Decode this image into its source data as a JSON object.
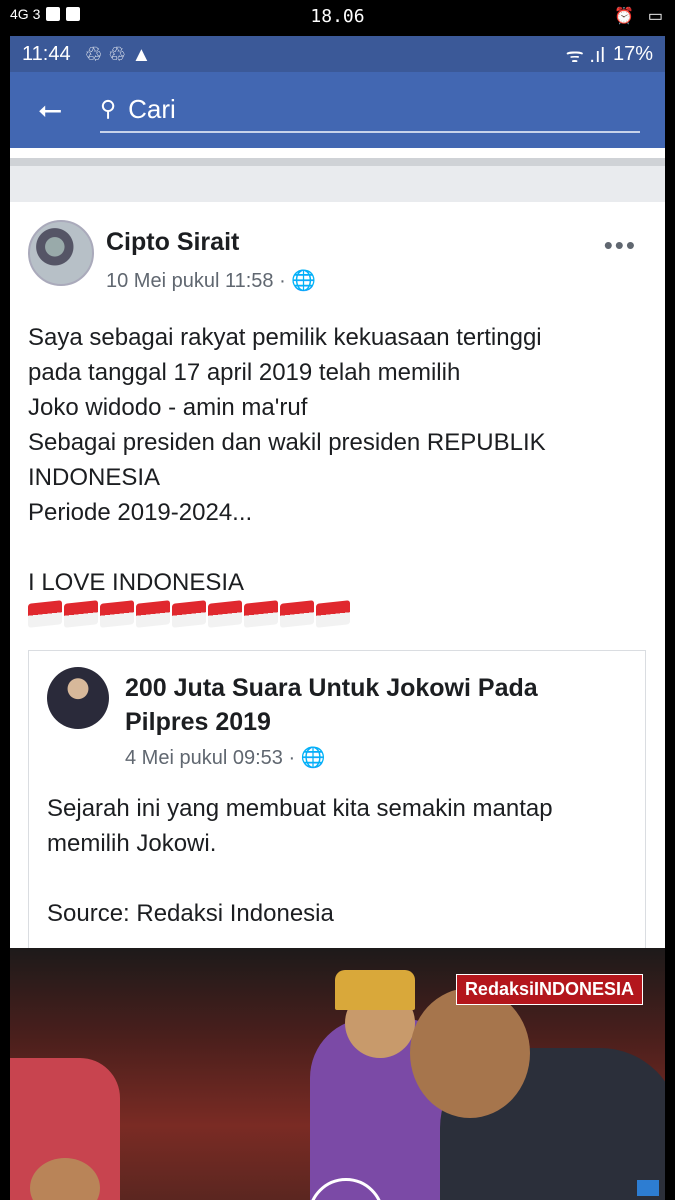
{
  "outer_status": {
    "left": "4G 3",
    "time": "18.06"
  },
  "status_bar": {
    "time": "11:44",
    "icons": "♲ ♲ ▲",
    "signal": "ᯤ .ıl",
    "battery": "17%"
  },
  "search": {
    "placeholder": "Cari"
  },
  "post": {
    "author": "Cipto Sirait",
    "meta": "10 Mei pukul 11:58 · 🌐",
    "more": "•••",
    "lines": [
      "Saya sebagai rakyat pemilik kekuasaan tertinggi",
      "pada tanggal 17 april 2019 telah memilih",
      "Joko widodo - amin ma'ruf",
      "Sebagai presiden dan wakil presiden REPUBLIK",
      "INDONESIA",
      "Periode 2019-2024...",
      "",
      "I LOVE INDONESIA"
    ],
    "flags": 9
  },
  "shared": {
    "title": "200 Juta Suara Untuk Jokowi Pada Pilpres 2019",
    "meta": "4 Mei pukul 09:53 · 🌐",
    "lines": [
      "Sejarah ini yang membuat kita semakin mantap",
      "memilih Jokowi.",
      "",
      "Source: Redaksi Indonesia"
    ]
  },
  "media": {
    "watermark": "RedaksiINDONESIA"
  }
}
